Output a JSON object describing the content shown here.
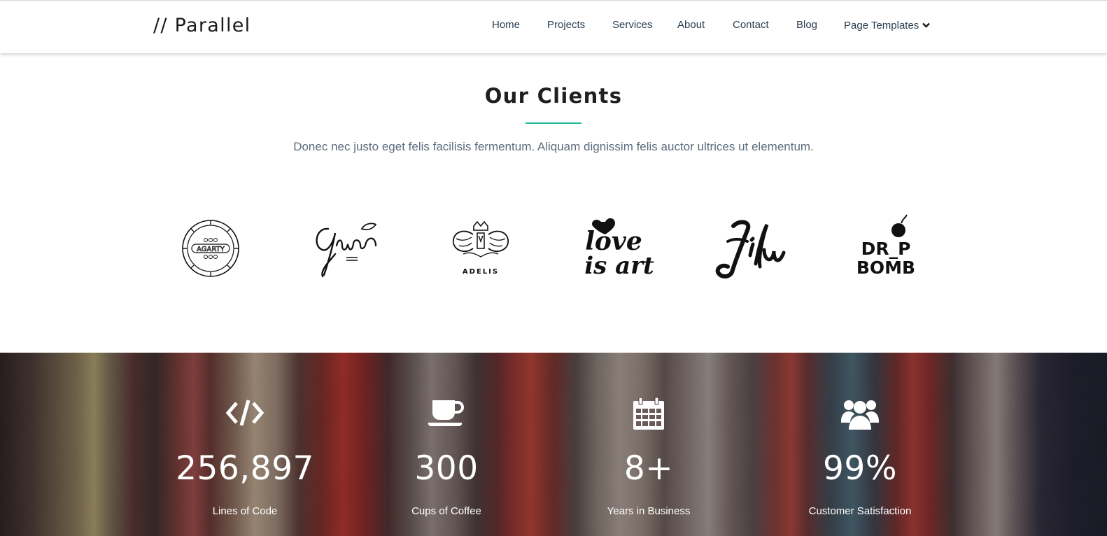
{
  "header": {
    "logo": "// Parallel",
    "nav": [
      {
        "label": "Home"
      },
      {
        "label": "Projects"
      },
      {
        "label": "Services"
      },
      {
        "label": "About"
      },
      {
        "label": "Contact"
      },
      {
        "label": "Blog"
      },
      {
        "label": "Page Templates",
        "icon": "chevron-down-icon"
      }
    ]
  },
  "clients": {
    "title": "Our Clients",
    "subtitle": "Donec nec justo eget felis facilisis fermentum. Aliquam dignissim felis auctor ultrices ut elementum.",
    "accent_color": "#1abc9c",
    "logos": [
      {
        "name": "agarty",
        "text": "AGARTY"
      },
      {
        "name": "azuan",
        "text": "Azuan"
      },
      {
        "name": "adelis",
        "text": "ADELIS"
      },
      {
        "name": "love-is-art",
        "text": "love is art"
      },
      {
        "name": "lilu",
        "text": "Lilu"
      },
      {
        "name": "drop-bomb",
        "text": "DROP BOMB"
      }
    ]
  },
  "stats": [
    {
      "icon": "code-icon",
      "value": "256,897",
      "label": "Lines of Code"
    },
    {
      "icon": "coffee-cup-icon",
      "value": "300",
      "label": "Cups of Coffee"
    },
    {
      "icon": "calendar-icon",
      "value": "8+",
      "label": "Years in Business"
    },
    {
      "icon": "users-icon",
      "value": "99%",
      "label": "Customer Satisfaction"
    }
  ]
}
